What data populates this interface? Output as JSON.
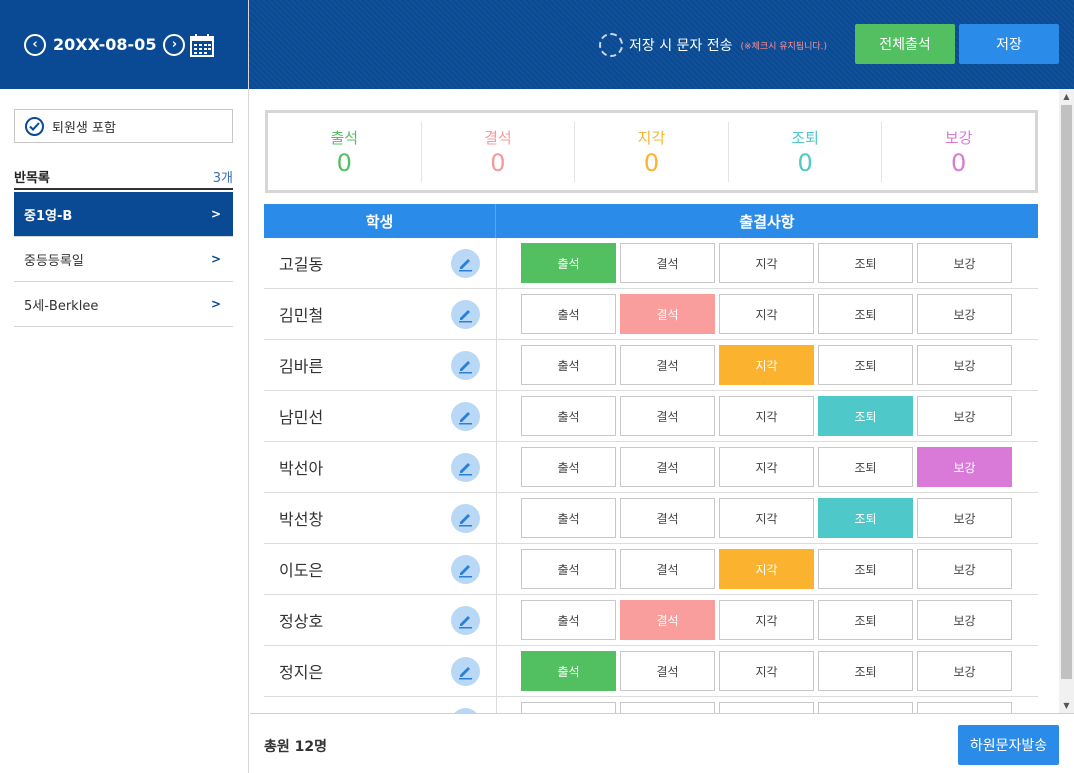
{
  "header": {
    "date": "20XX-08-05",
    "prev_icon": "chevron-left-icon",
    "next_icon": "chevron-right-icon",
    "calendar_icon": "calendar-icon"
  },
  "sidebar": {
    "include_withdrawn_label": "퇴원생 포함",
    "class_list_title": "반목록",
    "class_count": "3개",
    "classes": [
      {
        "label": "중1영-B",
        "active": true
      },
      {
        "label": "중등등록일",
        "active": false
      },
      {
        "label": "5세-Berklee",
        "active": false
      }
    ]
  },
  "topbar": {
    "sms_label": "저장 시 문자 전송",
    "sms_note": "(※체크시 유지됩니다.)",
    "mark_all_label": "전체출석",
    "save_label": "저장"
  },
  "summary": [
    {
      "label": "출석",
      "value": "0",
      "color": "#52c060"
    },
    {
      "label": "결석",
      "value": "0",
      "color": "#f49a9a"
    },
    {
      "label": "지각",
      "value": "0",
      "color": "#fbb22f"
    },
    {
      "label": "조퇴",
      "value": "0",
      "color": "#4ec8c8"
    },
    {
      "label": "보강",
      "value": "0",
      "color": "#d97ad9"
    }
  ],
  "table": {
    "col_student": "학생",
    "col_attendance": "출결사항",
    "options": [
      "출석",
      "결석",
      "지각",
      "조퇴",
      "보강"
    ],
    "rows": [
      {
        "name": "고길동",
        "selected": 0
      },
      {
        "name": "김민철",
        "selected": 1
      },
      {
        "name": "김바른",
        "selected": 2
      },
      {
        "name": "남민선",
        "selected": 3
      },
      {
        "name": "박선아",
        "selected": 4
      },
      {
        "name": "박선창",
        "selected": 3
      },
      {
        "name": "이도은",
        "selected": 2
      },
      {
        "name": "정상호",
        "selected": 1
      },
      {
        "name": "정지은",
        "selected": 0
      },
      {
        "name": "",
        "selected": -1
      }
    ]
  },
  "footer": {
    "total_label": "총원 12명",
    "sms_button_label": "하원문자발송"
  }
}
